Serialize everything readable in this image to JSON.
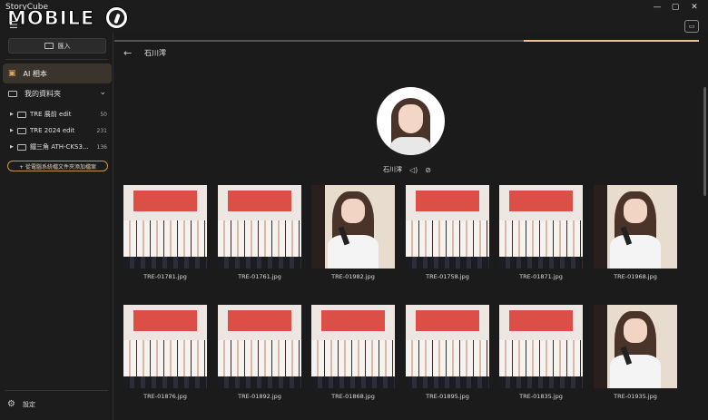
{
  "app": {
    "title": "StoryCube",
    "watermark": "MOBILE"
  },
  "window": {
    "minimize": "—",
    "maximize": "▢",
    "close": "✕"
  },
  "sidebar": {
    "import_label": "匯入",
    "ai_album_label": "AI 相本",
    "my_folders_label": "我的資料夾",
    "folders": [
      {
        "name": "TRE 展前 edit",
        "count": "50"
      },
      {
        "name": "TRE 2024 edit",
        "count": "231"
      },
      {
        "name": "鐵三角 ATH-CKS3...",
        "count": "136"
      }
    ],
    "add_folder_label": "+ 從電腦系統檔文件夾添加檔案",
    "settings_label": "設定"
  },
  "main": {
    "title": "石川澪",
    "progress": 0.7,
    "person_name": "石川澪",
    "photos": [
      {
        "file": "TRE-01781.jpg",
        "kind": "group"
      },
      {
        "file": "TRE-01761.jpg",
        "kind": "group"
      },
      {
        "file": "TRE-01982.jpg",
        "kind": "closeup"
      },
      {
        "file": "TRE-01758.jpg",
        "kind": "group"
      },
      {
        "file": "TRE-01871.jpg",
        "kind": "group"
      },
      {
        "file": "TRE-01968.jpg",
        "kind": "closeup"
      },
      {
        "file": "TRE-01876.jpg",
        "kind": "group"
      },
      {
        "file": "TRE-01892.jpg",
        "kind": "group"
      },
      {
        "file": "TRE-01868.jpg",
        "kind": "group"
      },
      {
        "file": "TRE-01895.jpg",
        "kind": "group"
      },
      {
        "file": "TRE-01835.jpg",
        "kind": "group"
      },
      {
        "file": "TRE-01935.jpg",
        "kind": "closeup"
      }
    ]
  },
  "colors": {
    "accent": "#c9954a",
    "progress": "#e8c590",
    "selected": "#3a342c"
  }
}
